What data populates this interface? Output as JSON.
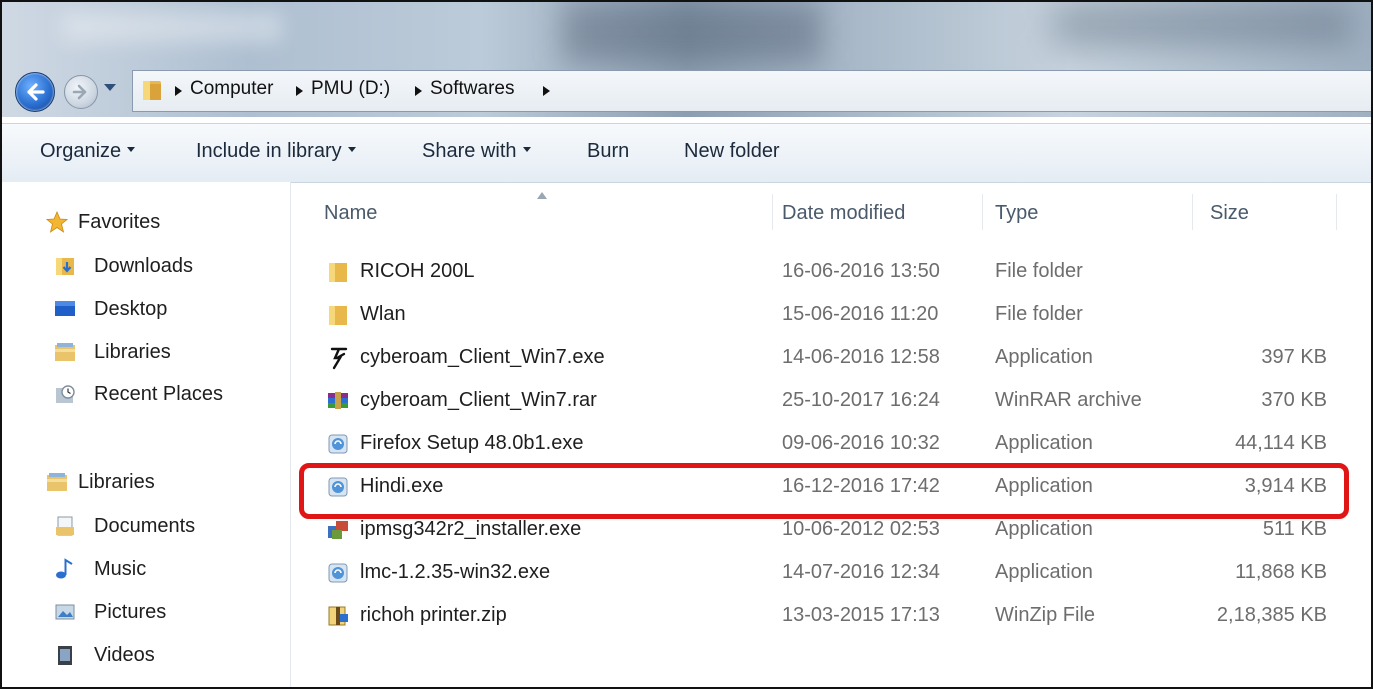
{
  "address": {
    "crumbs": [
      "Computer",
      "PMU (D:)",
      "Softwares"
    ]
  },
  "toolbar": {
    "organize": "Organize",
    "include": "Include in library",
    "share": "Share with",
    "burn": "Burn",
    "new_folder": "New folder"
  },
  "nav": {
    "favorites": "Favorites",
    "downloads": "Downloads",
    "desktop": "Desktop",
    "libraries_fav": "Libraries",
    "recent": "Recent Places",
    "libraries": "Libraries",
    "documents": "Documents",
    "music": "Music",
    "pictures": "Pictures",
    "videos": "Videos"
  },
  "columns": {
    "name": "Name",
    "date": "Date modified",
    "type": "Type",
    "size": "Size"
  },
  "files": [
    {
      "name": "RICOH 200L",
      "date": "16-06-2016 13:50",
      "type": "File folder",
      "size": "",
      "icon": "folder-icon"
    },
    {
      "name": "Wlan",
      "date": "15-06-2016 11:20",
      "type": "File folder",
      "size": "",
      "icon": "folder-icon"
    },
    {
      "name": "cyberoam_Client_Win7.exe",
      "date": "14-06-2016 12:58",
      "type": "Application",
      "size": "397 KB",
      "icon": "runner-app-icon"
    },
    {
      "name": "cyberoam_Client_Win7.rar",
      "date": "25-10-2017 16:24",
      "type": "WinRAR archive",
      "size": "370 KB",
      "icon": "winrar-icon"
    },
    {
      "name": "Firefox Setup 48.0b1.exe",
      "date": "09-06-2016 10:32",
      "type": "Application",
      "size": "44,114 KB",
      "icon": "installer-icon"
    },
    {
      "name": "Hindi.exe",
      "date": "16-12-2016 17:42",
      "type": "Application",
      "size": "3,914 KB",
      "icon": "installer-icon"
    },
    {
      "name": "ipmsg342r2_installer.exe",
      "date": "10-06-2012 02:53",
      "type": "Application",
      "size": "511 KB",
      "icon": "setup-app-icon"
    },
    {
      "name": "lmc-1.2.35-win32.exe",
      "date": "14-07-2016 12:34",
      "type": "Application",
      "size": "11,868 KB",
      "icon": "installer-icon"
    },
    {
      "name": "richoh printer.zip",
      "date": "13-03-2015 17:13",
      "type": "WinZip File",
      "size": "2,18,385 KB",
      "icon": "winzip-icon"
    }
  ],
  "highlight": {
    "color": "#e01616",
    "row": "Hindi.exe"
  }
}
